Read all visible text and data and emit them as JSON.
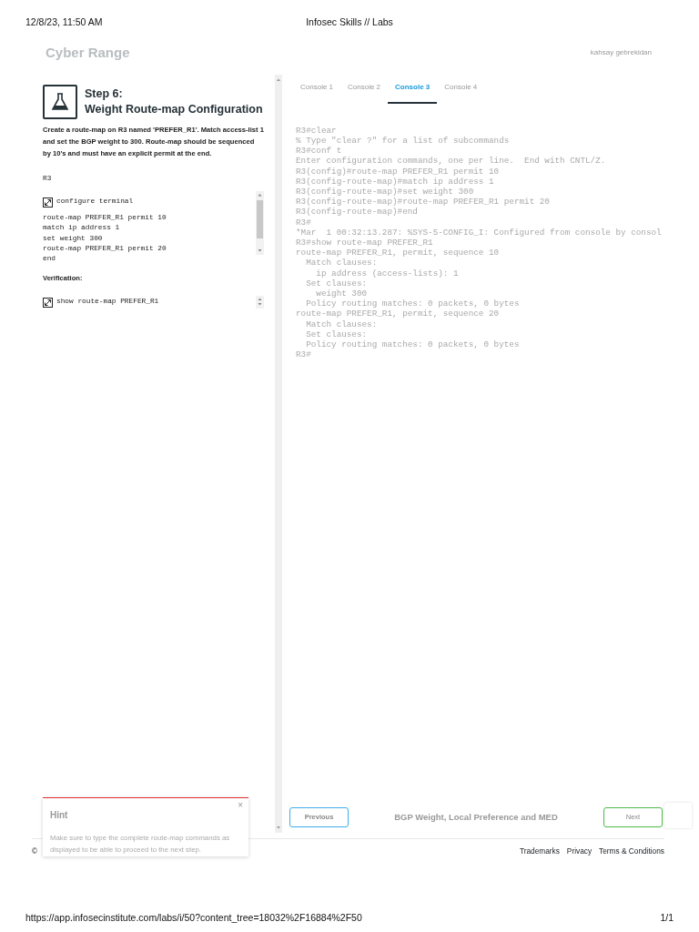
{
  "print_header": {
    "date": "12/8/23, 11:50 AM",
    "title": "Infosec Skills // Labs"
  },
  "header": {
    "logo": "Cyber Range",
    "user": "kahsay gebrekidan"
  },
  "step": {
    "title_line1": "Step 6:",
    "title_line2": "Weight Route-map Configuration",
    "description": "Create a route-map on R3 named 'PREFER_R1'. Match access-list 1 and set the BGP weight to 300. Route-map should be sequenced by 10's and must have an explicit permit at the end.",
    "device": "R3",
    "commands": [
      "configure terminal",
      "route-map PREFER_R1 permit 10",
      "match ip address 1",
      "set weight 300",
      "route-map PREFER_R1 permit 20",
      "end"
    ],
    "verification_label": "Verification:",
    "verification_commands": [
      "show route-map PREFER_R1"
    ]
  },
  "tabs": [
    {
      "label": "Console 1",
      "selected": false
    },
    {
      "label": "Console 2",
      "selected": false
    },
    {
      "label": "Console 3",
      "selected": true
    },
    {
      "label": "Console 4",
      "selected": false
    }
  ],
  "console_lines": [
    "R3#clear",
    "% Type \"clear ?\" for a list of subcommands",
    "R3#conf t",
    "Enter configuration commands, one per line.  End with CNTL/Z.",
    "R3(config)#route-map PREFER_R1 permit 10",
    "R3(config-route-map)#match ip address 1",
    "R3(config-route-map)#set weight 300",
    "R3(config-route-map)#route-map PREFER_R1 permit 20",
    "R3(config-route-map)#end",
    "R3#",
    "*Mar  1 00:32:13.287: %SYS-5-CONFIG_I: Configured from console by consol",
    "R3#show route-map PREFER_R1",
    "route-map PREFER_R1, permit, sequence 10",
    "  Match clauses:",
    "    ip address (access-lists): 1",
    "  Set clauses:",
    "    weight 300",
    "  Policy routing matches: 0 packets, 0 bytes",
    "route-map PREFER_R1, permit, sequence 20",
    "  Match clauses:",
    "  Set clauses:",
    "  Policy routing matches: 0 packets, 0 bytes",
    "R3#"
  ],
  "nav": {
    "previous": "Previous",
    "title": "BGP Weight, Local Preference and MED",
    "next": "Next"
  },
  "hint": {
    "title": "Hint",
    "close": "×",
    "text": "Make sure to type the complete route-map commands as displayed to be able to proceed to the next step."
  },
  "footer": {
    "copyright": "©",
    "links": [
      "Trademarks",
      "Privacy",
      "Terms & Conditions"
    ]
  },
  "print_footer": {
    "url": "https://app.infosecinstitute.com/labs/i/50?content_tree=18032%2F16884%2F50",
    "page": "1/1"
  }
}
